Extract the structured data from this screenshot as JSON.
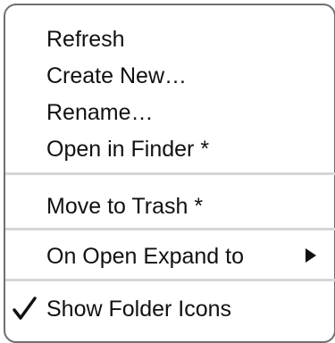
{
  "menu": {
    "items": [
      {
        "label": "Refresh"
      },
      {
        "label": "Create New…"
      },
      {
        "label": "Rename…"
      },
      {
        "label": "Open in Finder *"
      },
      {
        "label": "Move to Trash *"
      },
      {
        "label": "On Open Expand to",
        "submenu_icon": "submenu-arrow-icon"
      },
      {
        "label": "Show Folder Icons",
        "checked": true,
        "check_icon": "checkmark-icon"
      }
    ]
  }
}
